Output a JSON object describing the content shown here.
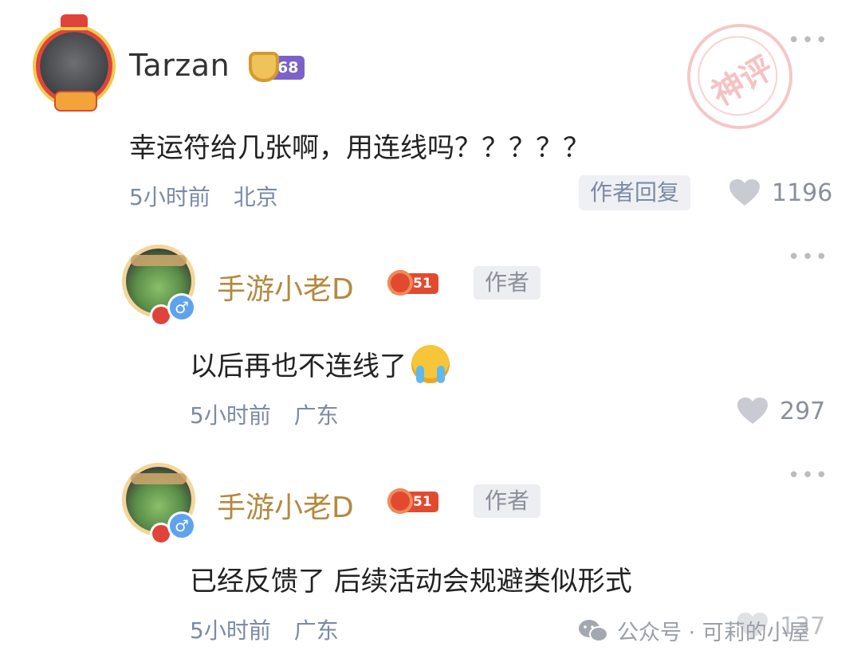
{
  "stamp": {
    "text": "神评"
  },
  "comment": {
    "username": "Tarzan",
    "level": "68",
    "text": "幸运符给几张啊，用连线吗？？？？？",
    "time": "5小时前",
    "location": "北京",
    "reply_label": "作者回复",
    "likes": "1196"
  },
  "replies": [
    {
      "username": "手游小老D",
      "level": "51",
      "author_tag": "作者",
      "text": "以后再也不连线了",
      "emoji": "crying-face-icon",
      "time": "5小时前",
      "location": "广东",
      "likes": "297"
    },
    {
      "username": "手游小老D",
      "level": "51",
      "author_tag": "作者",
      "text": "已经反馈了 后续活动会规避类似形式",
      "time": "5小时前",
      "location": "广东",
      "likes": "137"
    }
  ],
  "more_label": "•••",
  "watermark": {
    "text": "公众号 · 可莉的小屋",
    "icon": "wechat-icon"
  },
  "colors": {
    "username_main": "#333333",
    "username_author": "#b4893f",
    "meta": "#7c8aa5",
    "level_main": "#7b62c9",
    "level_author": "#e24a2f",
    "stamp": "#e25050"
  }
}
